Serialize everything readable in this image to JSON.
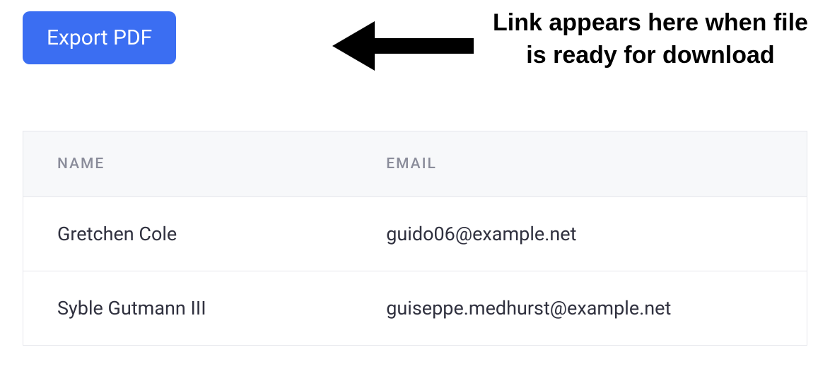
{
  "toolbar": {
    "export_label": "Export PDF"
  },
  "annotation": {
    "text": "Link appears here when file is ready for download"
  },
  "table": {
    "headers": {
      "name": "NAME",
      "email": "EMAIL"
    },
    "rows": [
      {
        "name": "Gretchen Cole",
        "email": "guido06@example.net"
      },
      {
        "name": "Syble Gutmann III",
        "email": "guiseppe.medhurst@example.net"
      }
    ]
  }
}
